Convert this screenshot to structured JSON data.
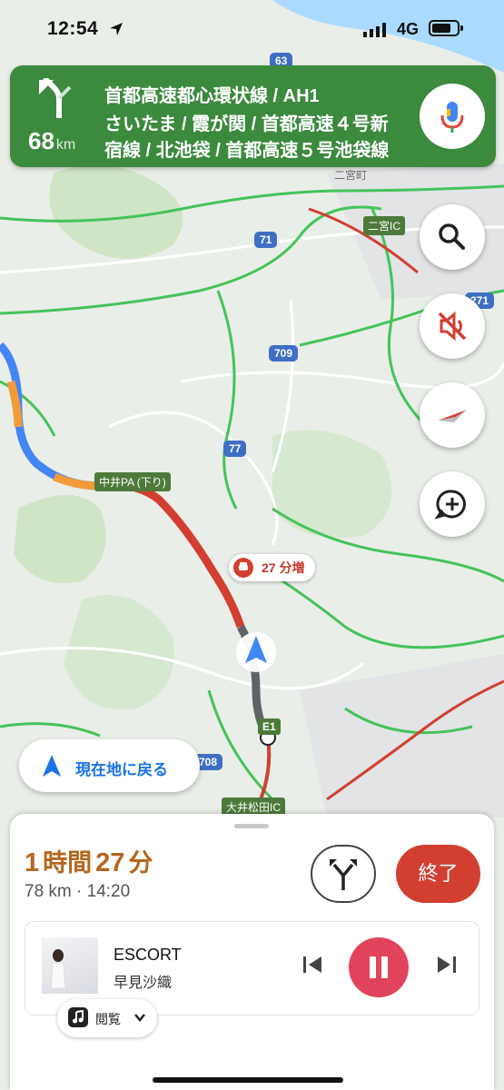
{
  "status_bar": {
    "time": "12:54",
    "network": "4G"
  },
  "guidance": {
    "distance_value": "68",
    "distance_unit": "km",
    "road_line1": "首都高速都心環状線 / AH1",
    "road_line2": "さいたま / 霞が関 / 首都高速４号新",
    "road_line3": "宿線 / 北池袋 / 首都高速５号池袋線"
  },
  "map": {
    "route_shields": [
      "63",
      "71",
      "709",
      "77",
      "271",
      "708"
    ],
    "interchange_labels": [
      "中井PA (下り)",
      "大井松田IC",
      "二宮IC",
      "E1"
    ],
    "place_labels": [
      "二宮町"
    ],
    "traffic_delay": "27 分増",
    "recenter_label": "現在地に戻る"
  },
  "trip": {
    "eta_hours": "1",
    "eta_hours_unit": "時間",
    "eta_minutes": "27",
    "eta_minutes_unit": "分",
    "summary": "78 km · 14:20",
    "end_label": "終了"
  },
  "media": {
    "track_title": "ESCORT",
    "artist": "早見沙織",
    "browse_label": "閲覧"
  },
  "colors": {
    "banner_green": "#3b8a3e",
    "route_blue": "#4285f4",
    "traffic_red": "#d23f31",
    "traffic_orange": "#f29b38",
    "end_button": "#d23f31",
    "pause_button": "#e2435c"
  },
  "icons": {
    "turn": "turn-slight-left-icon",
    "mic": "microphone-icon",
    "search": "search-icon",
    "mute": "volume-off-icon",
    "compass": "compass-icon",
    "report": "add-report-icon",
    "alt_routes": "alternate-routes-icon",
    "prev": "skip-previous-icon",
    "pause": "pause-icon",
    "next": "skip-next-icon"
  }
}
